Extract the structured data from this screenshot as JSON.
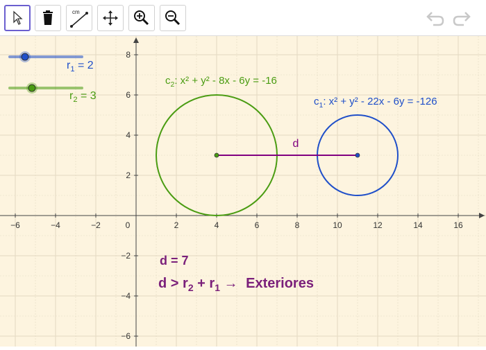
{
  "toolbar": {
    "tools": [
      {
        "name": "move-tool",
        "icon": "pointer-icon"
      },
      {
        "name": "delete-tool",
        "icon": "trash-icon"
      },
      {
        "name": "distance-tool",
        "icon": "ruler-icon",
        "caption": "cm"
      },
      {
        "name": "pan-tool",
        "icon": "move-arrows-icon"
      },
      {
        "name": "zoom-in-tool",
        "icon": "zoom-in-icon"
      },
      {
        "name": "zoom-out-tool",
        "icon": "zoom-out-icon"
      }
    ],
    "undo_icon": "undo-icon",
    "redo_icon": "redo-icon"
  },
  "sliders": [
    {
      "var": "r",
      "sub": "1",
      "eq": " = 2",
      "value": 2,
      "color": "#1f4fc9"
    },
    {
      "var": "r",
      "sub": "2",
      "eq": " = 3",
      "value": 3,
      "color": "#4a9c12"
    }
  ],
  "circles": [
    {
      "label_var": "c",
      "label_sub": "2",
      "equation": ": x² + y² - 8x - 6y = -16",
      "cx": 4,
      "cy": 3,
      "r": 3,
      "color": "#4a9c12"
    },
    {
      "label_var": "c",
      "label_sub": "1",
      "equation": ": x² + y² - 22x - 6y = -126",
      "cx": 11,
      "cy": 3,
      "r": 2,
      "color": "#1f4fc9"
    }
  ],
  "segment": {
    "label": "d",
    "color": "#800080"
  },
  "axes": {
    "x_ticks": [
      "-6",
      "-4",
      "-2",
      "0",
      "2",
      "4",
      "6",
      "8",
      "10",
      "12",
      "14",
      "16"
    ],
    "y_ticks": [
      "8",
      "6",
      "4",
      "2",
      "-2",
      "-4",
      "-6"
    ]
  },
  "results": {
    "distance": "d = 7",
    "relation_d": "d",
    "relation_gt": " > ",
    "relation_r2": "r",
    "relation_r2_sub": "2",
    "relation_plus": " + ",
    "relation_r1": "r",
    "relation_r1_sub": "1",
    "relation_arrow": " → ",
    "relation_word": "Exteriores"
  },
  "colors": {
    "background": "#fdf4df",
    "grid": "#e3d9c2",
    "text_result": "#7a1f7a"
  }
}
